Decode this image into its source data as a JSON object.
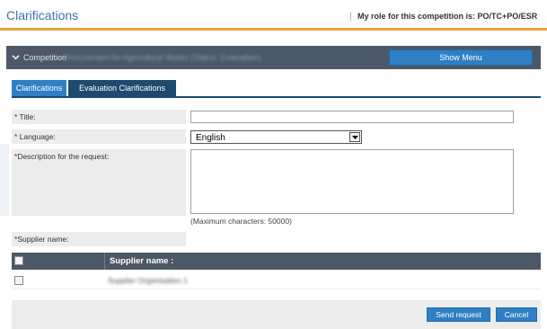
{
  "header": {
    "title": "Clarifications",
    "role_text": "My role for this competition is: PO/TC+PO/ESR"
  },
  "competition_bar": {
    "label": "Competition",
    "name": "Procurement for Agricultural Works (Status: Evaluation)",
    "show_menu_label": "Show Menu"
  },
  "tabs": [
    {
      "label": "Clarifications",
      "active": true
    },
    {
      "label": "Evaluation Clarifications",
      "active": false
    }
  ],
  "form": {
    "title_label": "Title:",
    "title_value": "",
    "language_label": "Language:",
    "language_value": "English",
    "description_label": "Description for the request:",
    "description_value": "",
    "max_chars_note": "(Maximum characters: 50000)",
    "supplier_label": "Supplier name:",
    "required_marker": "*"
  },
  "supplier_table": {
    "header": "Supplier name :",
    "rows": [
      {
        "name": "Supplier Organisation 1",
        "checked": false
      }
    ]
  },
  "actions": {
    "send_label": "Send request",
    "cancel_label": "Cancel"
  },
  "colors": {
    "accent_orange": "#e8a13a",
    "primary_blue": "#2f7fc4",
    "dark_slate": "#4c5866",
    "dark_tab": "#1d4a6e",
    "title_blue": "#3a72a8"
  }
}
